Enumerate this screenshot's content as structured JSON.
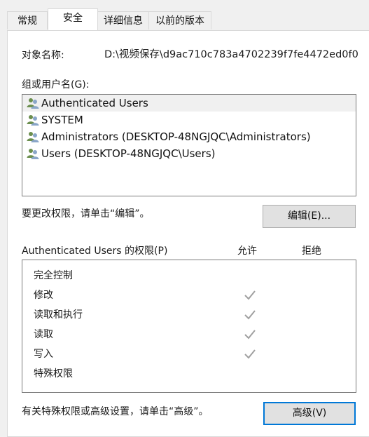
{
  "tabs": [
    {
      "label": "常规"
    },
    {
      "label": "安全"
    },
    {
      "label": "详细信息"
    },
    {
      "label": "以前的版本"
    }
  ],
  "object": {
    "label": "对象名称:",
    "value": "D:\\视频保存\\d9ac710c783a4702239f7fe4472ed0f0"
  },
  "groups": {
    "label": "组或用户名(G):",
    "items": [
      {
        "name": "Authenticated Users",
        "icon": "user-group-icon"
      },
      {
        "name": "SYSTEM",
        "icon": "user-group-icon"
      },
      {
        "name": "Administrators (DESKTOP-48NGJQC\\Administrators)",
        "icon": "user-group-icon"
      },
      {
        "name": "Users (DESKTOP-48NGJQC\\Users)",
        "icon": "user-group-icon"
      }
    ]
  },
  "edit": {
    "hint": "要更改权限，请单击“编辑”。",
    "button_label": "编辑(E)..."
  },
  "permissions": {
    "header": "Authenticated Users 的权限(P)",
    "allow_header": "允许",
    "deny_header": "拒绝",
    "rows": [
      {
        "name": "完全控制",
        "allow": false,
        "deny": false
      },
      {
        "name": "修改",
        "allow": true,
        "deny": false
      },
      {
        "name": "读取和执行",
        "allow": true,
        "deny": false
      },
      {
        "name": "读取",
        "allow": true,
        "deny": false
      },
      {
        "name": "写入",
        "allow": true,
        "deny": false
      },
      {
        "name": "特殊权限",
        "allow": false,
        "deny": false
      }
    ]
  },
  "advanced": {
    "hint": "有关特殊权限或高级设置，请单击“高级”。",
    "button_label": "高级(V)"
  },
  "colors": {
    "focus_border": "#0078d7",
    "check_gray": "#a0a0a0",
    "selected_row": "#f0f0f0"
  }
}
